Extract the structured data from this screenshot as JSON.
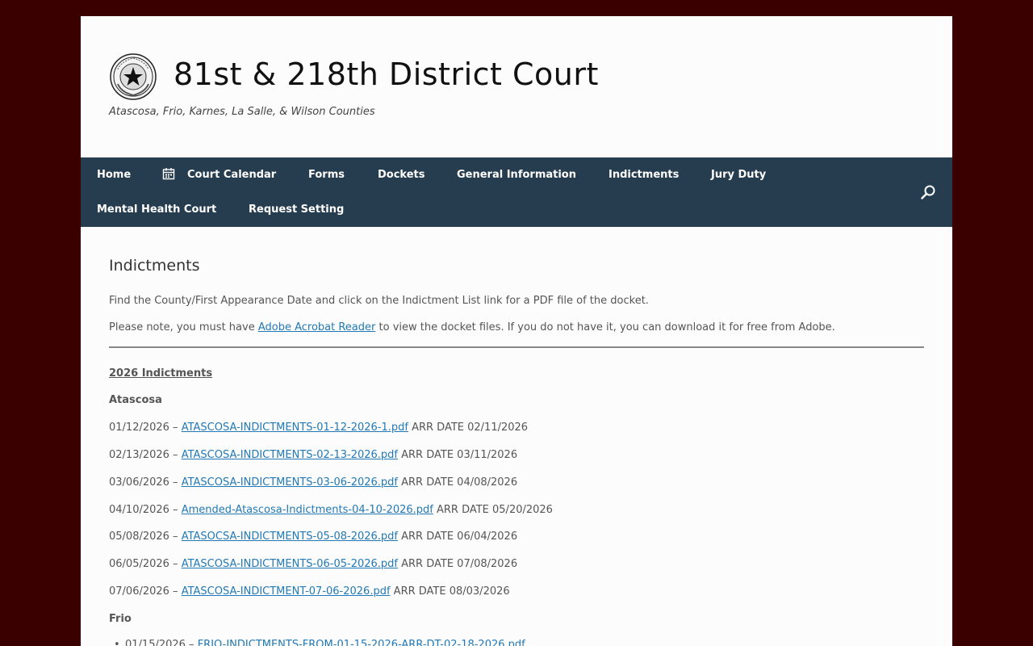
{
  "site": {
    "title": "81st & 218th District Court",
    "description": "Atascosa, Frio, Karnes, La Salle, & Wilson Counties",
    "seal_text": "THE STATE OF TEXAS"
  },
  "nav": {
    "home": "Home",
    "court_calendar": "Court Calendar",
    "forms": "Forms",
    "dockets": "Dockets",
    "general_information": "General Information",
    "indictments": "Indictments",
    "jury_duty": "Jury Duty",
    "mental_health_court": "Mental Health Court",
    "request_setting": "Request Setting"
  },
  "content": {
    "page_title": "Indictments",
    "intro": "Find the County/First Appearance Date and click on the Indictment List link for a PDF file of the docket.",
    "note_before": "Please note, you must have ",
    "note_link": "Adobe Acrobat Reader",
    "note_after": " to view the docket files. If you do not have it, you can download it for free from Adobe.",
    "year_heading": "2026 Indictments",
    "atascosa_heading": "Atascosa",
    "atascosa_entries": [
      {
        "date": "01/12/2026 – ",
        "file": "ATASCOSA-INDICTMENTS-01-12-2026-1.pdf",
        "arr": " ARR DATE 02/11/2026"
      },
      {
        "date": "02/13/2026 – ",
        "file": "ATASCOSA-INDICTMENTS-02-13-2026.pdf",
        "arr": " ARR DATE 03/11/2026"
      },
      {
        "date": "03/06/2026 – ",
        "file": "ATASCOSA-INDICTMENTS-03-06-2026.pdf",
        "arr": " ARR DATE 04/08/2026"
      },
      {
        "date": "04/10/2026 – ",
        "file": "Amended-Atascosa-Indictments-04-10-2026.pdf",
        "arr": " ARR DATE 05/20/2026"
      },
      {
        "date": "05/08/2026 – ",
        "file": "ATASOCSA-INDICTMENTS-05-08-2026.pdf",
        "arr": " ARR DATE 06/04/2026"
      },
      {
        "date": "06/05/2026 – ",
        "file": "ATASCOSA-INDICTMENTS-06-05-2026.pdf",
        "arr": " ARR DATE 07/08/2026"
      },
      {
        "date": "07/06/2026 – ",
        "file": "ATASCOSA-INDICTMENT-07-06-2026.pdf",
        "arr": " ARR DATE 08/03/2026"
      }
    ],
    "frio_heading": "Frio",
    "frio_entries": [
      {
        "date": "01/15/2026 – ",
        "file": "FRIO-INDICTMENTS-FROM-01-15-2026-ARR-DT-02-18-2026.pdf"
      }
    ]
  },
  "icons": {
    "calendar": "calendar-icon",
    "search": "search-icon",
    "seal": "texas-seal-logo"
  },
  "colors": {
    "outer_background": "#3a0000",
    "nav_background": "#263d50",
    "link": "#2279b5"
  }
}
